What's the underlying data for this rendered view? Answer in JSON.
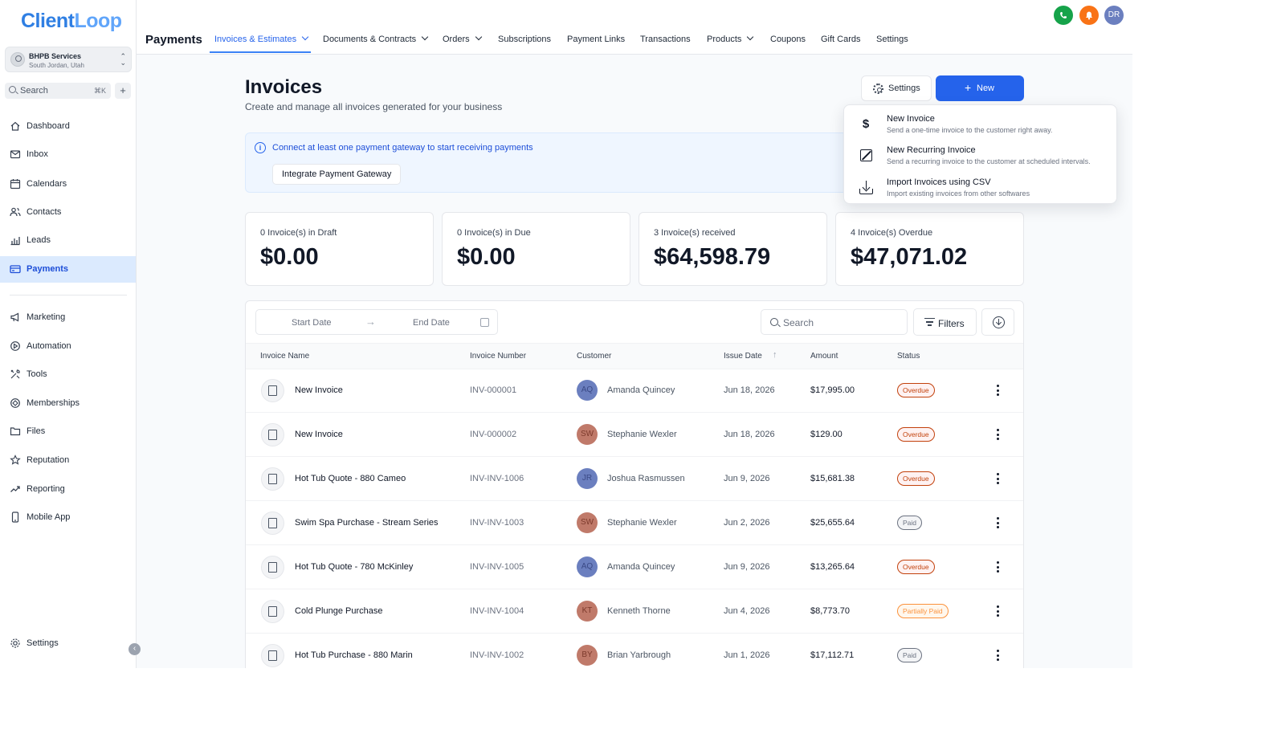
{
  "brand": {
    "logo_text_a": "Client",
    "logo_text_b": "Loop"
  },
  "account": {
    "name": "BHPB Services",
    "location": "South Jordan, Utah"
  },
  "sidebar_search": {
    "placeholder": "Search",
    "shortcut": "⌘K"
  },
  "sidebar": {
    "items": [
      {
        "label": "Dashboard",
        "icon": "home-icon"
      },
      {
        "label": "Inbox",
        "icon": "mail-icon"
      },
      {
        "label": "Calendars",
        "icon": "calendar-icon"
      },
      {
        "label": "Contacts",
        "icon": "users-icon"
      },
      {
        "label": "Leads",
        "icon": "bar-chart-icon"
      },
      {
        "label": "Payments",
        "icon": "credit-card-icon",
        "active": true
      }
    ],
    "items2": [
      {
        "label": "Marketing",
        "icon": "megaphone-icon"
      },
      {
        "label": "Automation",
        "icon": "automation-icon"
      },
      {
        "label": "Tools",
        "icon": "tools-icon"
      },
      {
        "label": "Memberships",
        "icon": "membership-icon"
      },
      {
        "label": "Files",
        "icon": "folder-icon"
      },
      {
        "label": "Reputation",
        "icon": "star-icon"
      },
      {
        "label": "Reporting",
        "icon": "trend-icon"
      },
      {
        "label": "Mobile App",
        "icon": "mobile-icon"
      }
    ],
    "settings_label": "Settings"
  },
  "topbar": {
    "title": "Payments",
    "tabs": [
      {
        "label": "Invoices & Estimates",
        "dropdown": true,
        "active": true
      },
      {
        "label": "Documents & Contracts",
        "dropdown": true
      },
      {
        "label": "Orders",
        "dropdown": true
      },
      {
        "label": "Subscriptions"
      },
      {
        "label": "Payment Links"
      },
      {
        "label": "Transactions"
      },
      {
        "label": "Products",
        "dropdown": true
      },
      {
        "label": "Coupons"
      },
      {
        "label": "Gift Cards"
      },
      {
        "label": "Settings"
      }
    ],
    "user_initials": "DR",
    "colors": {
      "phone": "#16a34a",
      "bell": "#f97316",
      "avatar": "#6b7fbf"
    }
  },
  "page": {
    "title": "Invoices",
    "subtitle": "Create and manage all invoices generated for your business",
    "settings_button": "Settings",
    "new_button": "New"
  },
  "banner": {
    "message": "Connect at least one payment gateway to start receiving payments",
    "button": "Integrate Payment Gateway"
  },
  "new_menu": {
    "items": [
      {
        "title": "New Invoice",
        "desc": "Send a one-time invoice to the customer right away."
      },
      {
        "title": "New Recurring Invoice",
        "desc": "Send a recurring invoice to the customer at scheduled intervals."
      },
      {
        "title": "Import Invoices using CSV",
        "desc": "Import existing invoices from other softwares"
      }
    ]
  },
  "stats": [
    {
      "label": "0 Invoice(s) in Draft",
      "value": "$0.00"
    },
    {
      "label": "0 Invoice(s) in Due",
      "value": "$0.00"
    },
    {
      "label": "3 Invoice(s) received",
      "value": "$64,598.79"
    },
    {
      "label": "4 Invoice(s) Overdue",
      "value": "$47,071.02"
    }
  ],
  "table": {
    "filters": {
      "start_date": "Start Date",
      "end_date": "End Date",
      "search_placeholder": "Search",
      "filters_label": "Filters"
    },
    "columns": [
      "Invoice Name",
      "Invoice Number",
      "Customer",
      "Issue Date",
      "Amount",
      "Status"
    ],
    "rows": [
      {
        "name": "New Invoice",
        "number": "INV-000001",
        "initials": "AQ",
        "customer": "Amanda Quincey",
        "date": "Jun 18, 2026",
        "amount": "$17,995.00",
        "status": "Overdue"
      },
      {
        "name": "New Invoice",
        "number": "INV-000002",
        "initials": "SW",
        "customer": "Stephanie Wexler",
        "date": "Jun 18, 2026",
        "amount": "$129.00",
        "status": "Overdue"
      },
      {
        "name": "Hot Tub Quote - 880 Cameo",
        "number": "INV-INV-1006",
        "initials": "JR",
        "customer": "Joshua Rasmussen",
        "date": "Jun 9, 2026",
        "amount": "$15,681.38",
        "status": "Overdue"
      },
      {
        "name": "Swim Spa Purchase - Stream Series",
        "number": "INV-INV-1003",
        "initials": "SW",
        "customer": "Stephanie Wexler",
        "date": "Jun 2, 2026",
        "amount": "$25,655.64",
        "status": "Paid"
      },
      {
        "name": "Hot Tub Quote - 780 McKinley",
        "number": "INV-INV-1005",
        "initials": "AQ",
        "customer": "Amanda Quincey",
        "date": "Jun 9, 2026",
        "amount": "$13,265.64",
        "status": "Overdue"
      },
      {
        "name": "Cold Plunge Purchase",
        "number": "INV-INV-1004",
        "initials": "KT",
        "customer": "Kenneth Thorne",
        "date": "Jun 4, 2026",
        "amount": "$8,773.70",
        "status": "Partially Paid"
      },
      {
        "name": "Hot Tub Purchase - 880 Marin",
        "number": "INV-INV-1002",
        "initials": "BY",
        "customer": "Brian Yarbrough",
        "date": "Jun 1, 2026",
        "amount": "$17,112.71",
        "status": "Paid"
      }
    ]
  },
  "colors": {
    "accent": "#2563eb",
    "active_nav_bg": "#dbeafe",
    "banner_bg": "#eff6ff"
  }
}
